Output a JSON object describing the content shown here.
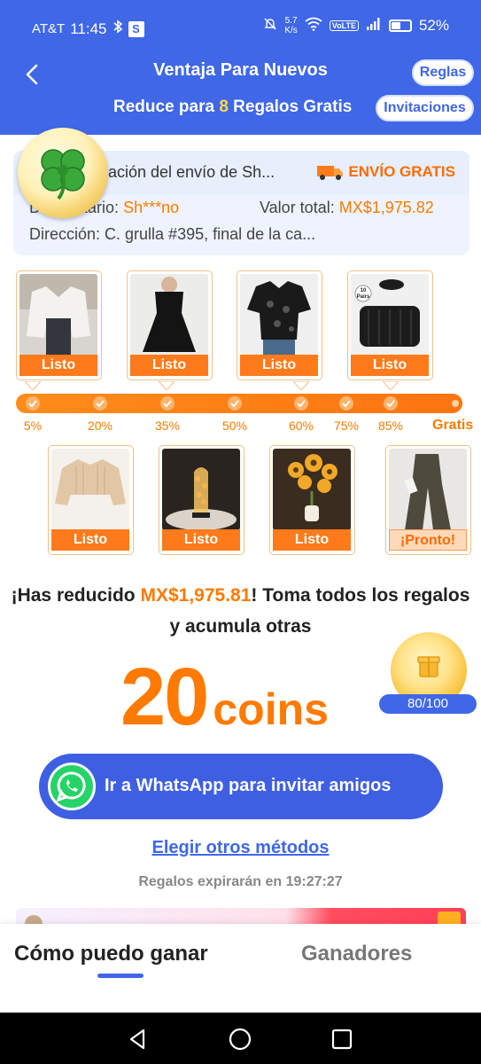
{
  "status_bar": {
    "carrier": "AT&T",
    "time": "11:45",
    "s_badge": "S",
    "speed_value": "5.7",
    "speed_unit": "K/s",
    "volte": "VoLTE",
    "battery": "52%",
    "battery_level": 0.52
  },
  "header": {
    "title": "Ventaja Para Nuevos",
    "subtitle_pre": "Reduce para ",
    "subtitle_num": "8",
    "subtitle_post": " Regalos Gratis",
    "rules_label": "Reglas",
    "invites_label": "Invitaciones"
  },
  "shipping": {
    "title": "rmación del envío de Sh...",
    "free_label": "ENVÍO GRATIS",
    "recipient_label": "Destinatario: ",
    "recipient_value": "Sh***no",
    "total_label": "Valor total: ",
    "total_value": "MX$1,975.82",
    "address": "Dirección: C. grulla #395, final de la ca..."
  },
  "top_products": [
    {
      "tag": "Listo",
      "pairs_label": ""
    },
    {
      "tag": "Listo",
      "pairs_label": ""
    },
    {
      "tag": "Listo",
      "pairs_label": ""
    },
    {
      "tag": "Listo",
      "pairs_label": "10 Pairs"
    }
  ],
  "progress": {
    "steps": [
      "5%",
      "20%",
      "35%",
      "50%",
      "60%",
      "75%",
      "85%"
    ],
    "end_label": "Gratis"
  },
  "bottom_products": [
    {
      "tag": "Listo"
    },
    {
      "tag": "Listo"
    },
    {
      "tag": "Listo"
    },
    {
      "tag": "¡Pronto!"
    }
  ],
  "message": {
    "pre": "¡Has reducido ",
    "amount": "MX$1,975.81",
    "post": "! Toma todos los regalos y acumula otras"
  },
  "coins": {
    "number": "20",
    "label": "coins",
    "progress_text": "80/100"
  },
  "actions": {
    "whatsapp_label": "Ir a WhatsApp para invitar amigos",
    "other_methods": "Elegir otros métodos",
    "expire_text": "Regalos expirarán en 19:27:27"
  },
  "tabs": {
    "active": "Cómo puedo ganar",
    "inactive": "Ganadores"
  },
  "colors": {
    "brand_blue": "#3f67e6",
    "accent_orange": "#ff7a00",
    "highlight_yellow": "#ffd84a"
  }
}
